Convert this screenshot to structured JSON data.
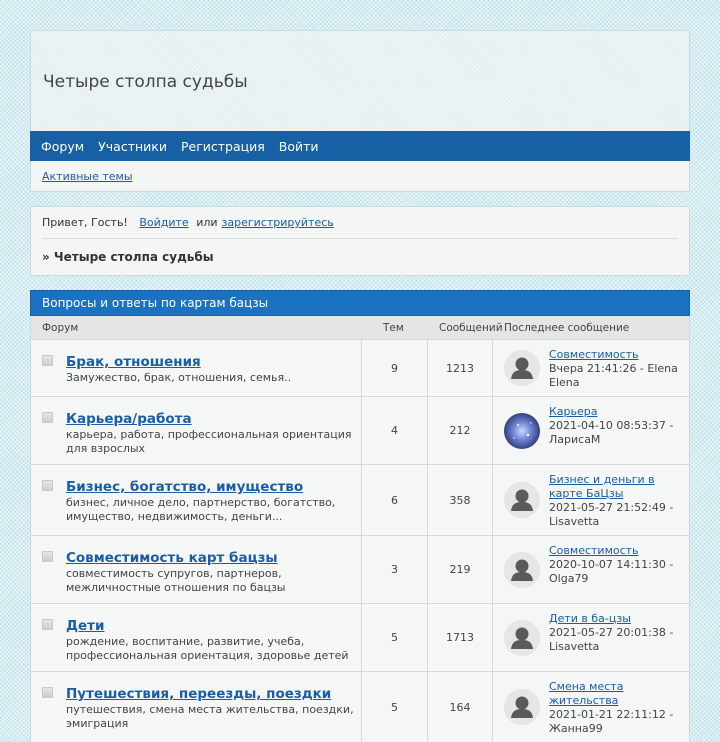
{
  "site": {
    "title": "Четыре столпа судьбы"
  },
  "nav": {
    "items": [
      "Форум",
      "Участники",
      "Регистрация",
      "Войти"
    ]
  },
  "subnav": {
    "active_topics": "Активные темы"
  },
  "welcome": {
    "greeting": "Привет, Гость!",
    "login_link": "Войдите",
    "or": "или",
    "register_link": "зарегистрируйтесь",
    "period": ".",
    "breadcrumb": "» Четыре столпа судьбы"
  },
  "category": {
    "title": "Вопросы и ответы по картам бацзы",
    "col_forum": "Форум",
    "col_topics": "Тем",
    "col_posts": "Сообщений",
    "col_last": "Последнее сообщение"
  },
  "forums": [
    {
      "title": "Брак, отношения",
      "desc": "Замужество, брак, отношения, семья..",
      "topics": "9",
      "posts": "1213",
      "last_title": "Совместимость",
      "last_meta": "Вчера 21:41:26 - Elena Elena",
      "avatar": "default-avatar-icon"
    },
    {
      "title": "Карьера/работа",
      "desc": "карьера, работа, профессиональная ориентация для взрослых",
      "topics": "4",
      "posts": "212",
      "last_title": "Карьера",
      "last_meta": "2021-04-10 08:53:37 - ЛарисаМ",
      "avatar": "galaxy-avatar-image"
    },
    {
      "title": "Бизнес, богатство, имущество",
      "desc": "бизнес, личное дело, партнерство, богатство, имущество, недвижимость, деньги...",
      "topics": "6",
      "posts": "358",
      "last_title": "Бизнес и деньги в карте БаЦзы",
      "last_meta": "2021-05-27 21:52:49 - Lisavetta",
      "avatar": "default-avatar-icon"
    },
    {
      "title": "Совместимость карт бацзы",
      "desc": "совместимость супругов, партнеров, межличностные отношения по бацзы",
      "topics": "3",
      "posts": "219",
      "last_title": "Совместимость",
      "last_meta": "2020-10-07 14:11:30 - Olga79",
      "avatar": "default-avatar-icon"
    },
    {
      "title": "Дети",
      "desc": "рождение, воспитание, развитие, учеба, профессиональная ориентация, здоровье детей",
      "topics": "5",
      "posts": "1713",
      "last_title": "Дети в ба-цзы",
      "last_meta": "2021-05-27 20:01:38 - Lisavetta",
      "avatar": "default-avatar-icon"
    },
    {
      "title": "Путешествия, переезды, поездки",
      "desc": "путешествия, смена места жительства, поездки, эмиграция",
      "topics": "5",
      "posts": "164",
      "last_title": "Смена места жительства",
      "last_meta": "2021-01-21 22:11:12 - Жанна99",
      "avatar": "default-avatar-icon"
    }
  ]
}
